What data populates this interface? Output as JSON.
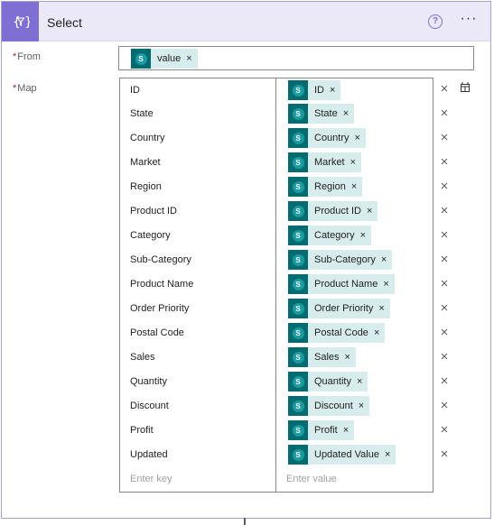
{
  "header": {
    "title": "Select",
    "icon": "data-operation-icon",
    "help_icon": "help-icon",
    "more_icon": "more-icon",
    "help_glyph": "?",
    "more_glyph": "···"
  },
  "fields": {
    "from_label": "From",
    "map_label": "Map",
    "required_mark": "*"
  },
  "from": {
    "token_label": "value"
  },
  "connector_icon": "sharepoint-icon",
  "remove_glyph": "×",
  "map": {
    "rows": [
      {
        "key": "ID",
        "value": "ID"
      },
      {
        "key": "State",
        "value": "State"
      },
      {
        "key": "Country",
        "value": "Country"
      },
      {
        "key": "Market",
        "value": "Market"
      },
      {
        "key": "Region",
        "value": "Region"
      },
      {
        "key": "Product ID",
        "value": "Product ID"
      },
      {
        "key": "Category",
        "value": "Category"
      },
      {
        "key": "Sub-Category",
        "value": "Sub-Category"
      },
      {
        "key": "Product Name",
        "value": "Product Name"
      },
      {
        "key": "Order Priority",
        "value": "Order Priority"
      },
      {
        "key": "Postal Code",
        "value": "Postal Code"
      },
      {
        "key": "Sales",
        "value": "Sales"
      },
      {
        "key": "Quantity",
        "value": "Quantity"
      },
      {
        "key": "Discount",
        "value": "Discount"
      },
      {
        "key": "Profit",
        "value": "Profit"
      },
      {
        "key": "Updated",
        "value": "Updated Value"
      }
    ],
    "key_placeholder": "Enter key",
    "value_placeholder": "Enter value"
  },
  "colors": {
    "accent": "#7f6fd2",
    "header_bg": "#ebe9f7",
    "sharepoint": "#036c70",
    "token_bg": "#d7ecec"
  }
}
